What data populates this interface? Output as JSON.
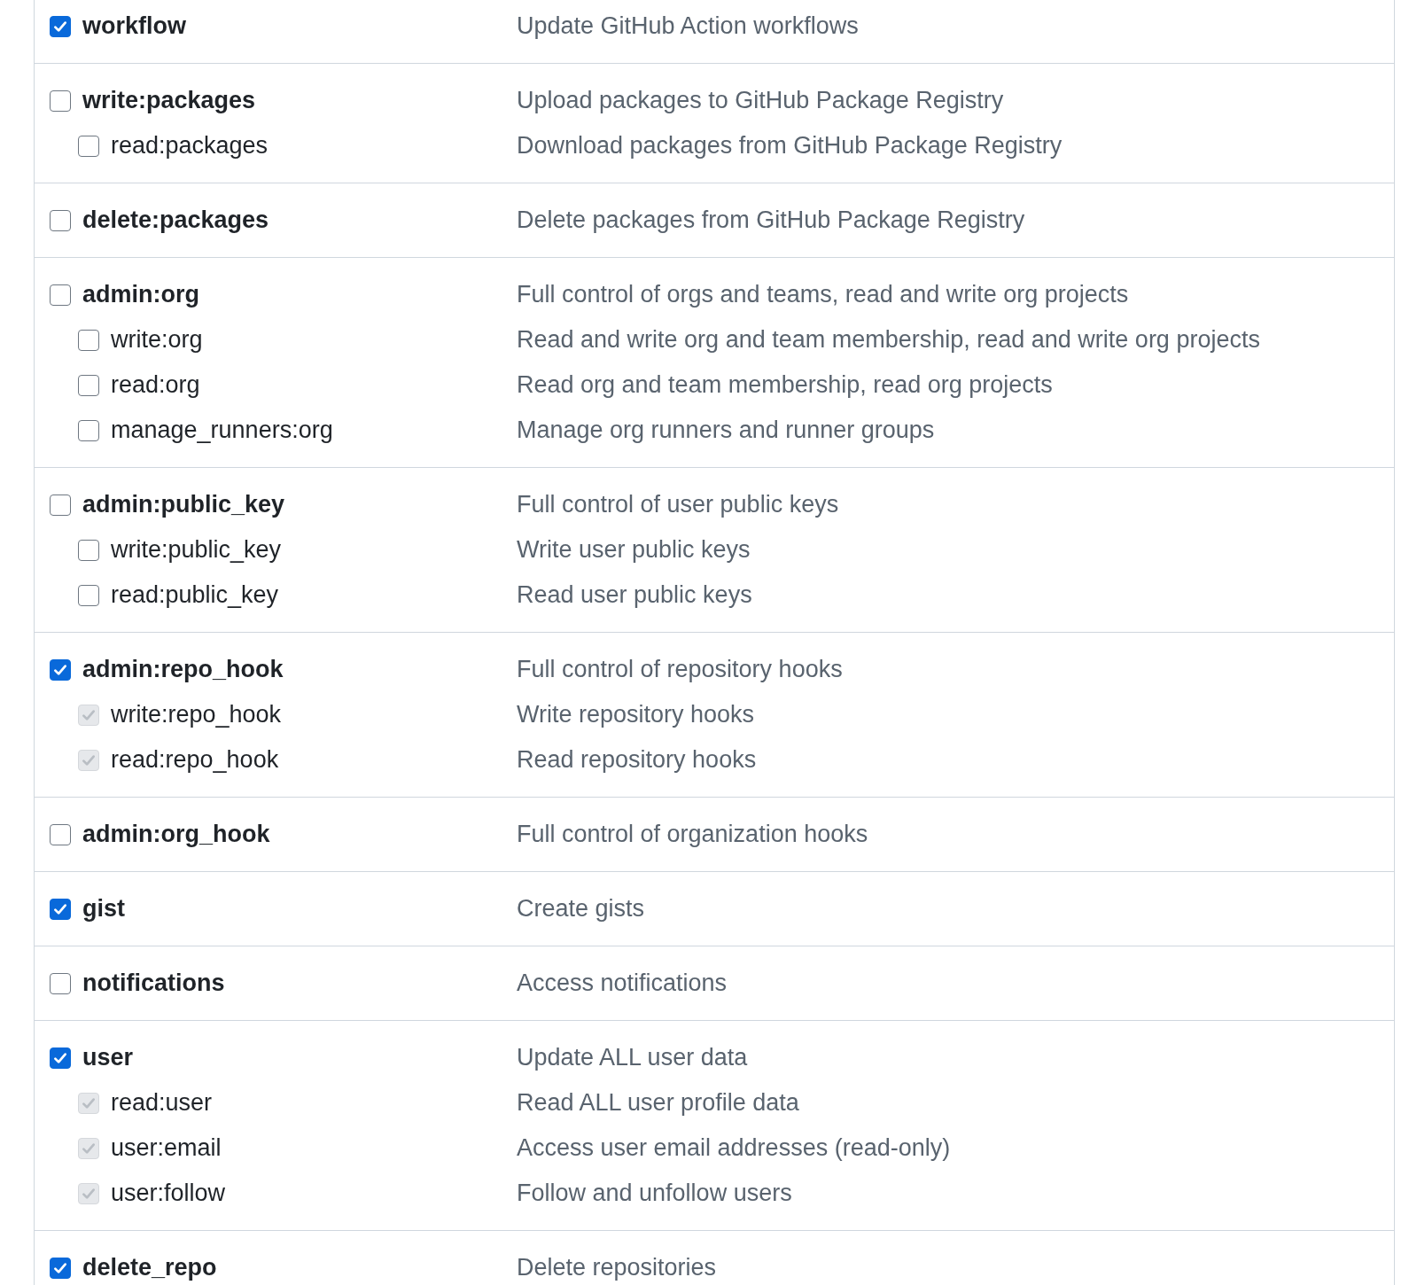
{
  "scopes": [
    {
      "name": "workflow",
      "description": "Update GitHub Action workflows",
      "checked": true
    },
    {
      "name": "write:packages",
      "description": "Upload packages to GitHub Package Registry",
      "checked": false,
      "children": [
        {
          "name": "read:packages",
          "description": "Download packages from GitHub Package Registry",
          "checked": false,
          "disabled": false
        }
      ]
    },
    {
      "name": "delete:packages",
      "description": "Delete packages from GitHub Package Registry",
      "checked": false
    },
    {
      "name": "admin:org",
      "description": "Full control of orgs and teams, read and write org projects",
      "checked": false,
      "children": [
        {
          "name": "write:org",
          "description": "Read and write org and team membership, read and write org projects",
          "checked": false,
          "disabled": false
        },
        {
          "name": "read:org",
          "description": "Read org and team membership, read org projects",
          "checked": false,
          "disabled": false
        },
        {
          "name": "manage_runners:org",
          "description": "Manage org runners and runner groups",
          "checked": false,
          "disabled": false
        }
      ]
    },
    {
      "name": "admin:public_key",
      "description": "Full control of user public keys",
      "checked": false,
      "children": [
        {
          "name": "write:public_key",
          "description": "Write user public keys",
          "checked": false,
          "disabled": false
        },
        {
          "name": "read:public_key",
          "description": "Read user public keys",
          "checked": false,
          "disabled": false
        }
      ]
    },
    {
      "name": "admin:repo_hook",
      "description": "Full control of repository hooks",
      "checked": true,
      "children": [
        {
          "name": "write:repo_hook",
          "description": "Write repository hooks",
          "checked": true,
          "disabled": true
        },
        {
          "name": "read:repo_hook",
          "description": "Read repository hooks",
          "checked": true,
          "disabled": true
        }
      ]
    },
    {
      "name": "admin:org_hook",
      "description": "Full control of organization hooks",
      "checked": false
    },
    {
      "name": "gist",
      "description": "Create gists",
      "checked": true
    },
    {
      "name": "notifications",
      "description": "Access notifications",
      "checked": false
    },
    {
      "name": "user",
      "description": "Update ALL user data",
      "checked": true,
      "children": [
        {
          "name": "read:user",
          "description": "Read ALL user profile data",
          "checked": true,
          "disabled": true
        },
        {
          "name": "user:email",
          "description": "Access user email addresses (read-only)",
          "checked": true,
          "disabled": true
        },
        {
          "name": "user:follow",
          "description": "Follow and unfollow users",
          "checked": true,
          "disabled": true
        }
      ]
    },
    {
      "name": "delete_repo",
      "description": "Delete repositories",
      "checked": true
    }
  ]
}
